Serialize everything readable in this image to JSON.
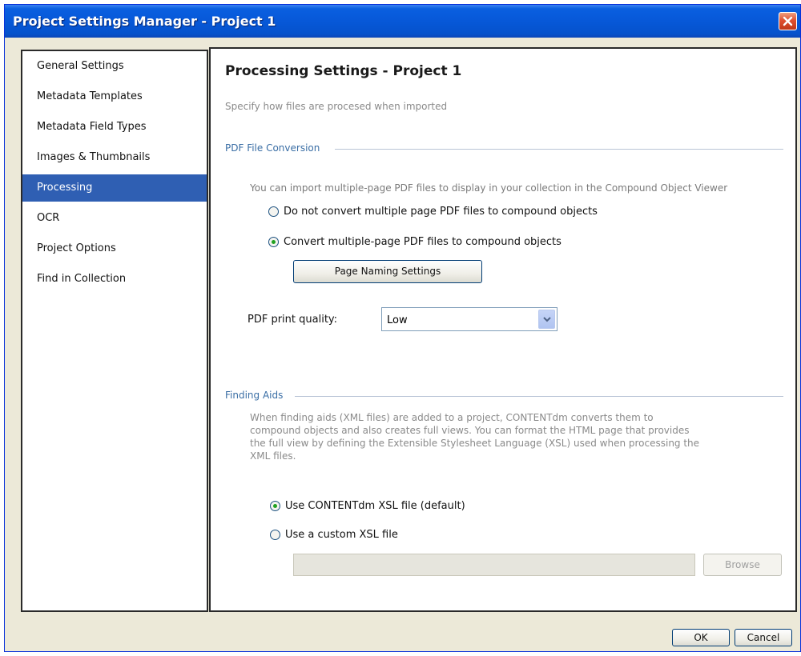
{
  "window": {
    "title": "Project Settings Manager - Project 1",
    "close_icon": "close-x-icon",
    "titlebar_color": "#0758d8"
  },
  "sidebar": {
    "items": [
      {
        "label": "General Settings"
      },
      {
        "label": "Metadata Templates"
      },
      {
        "label": "Metadata Field Types"
      },
      {
        "label": "Images & Thumbnails"
      },
      {
        "label": "Processing",
        "active": true
      },
      {
        "label": "OCR"
      },
      {
        "label": "Project Options"
      },
      {
        "label": "Find in Collection"
      }
    ],
    "active_color": "#2f5fb3"
  },
  "main": {
    "title": "Processing Settings - Project 1",
    "subtitle": "Specify how files are procesed when imported",
    "pdf_section": {
      "label": "PDF File Conversion",
      "description": "You can import multiple-page PDF files to display in your collection in the Compound Object Viewer",
      "option_no_convert": "Do not convert multiple page PDF files to compound objects",
      "option_convert": "Convert multiple-page PDF files to compound objects",
      "selected_option": "convert",
      "page_naming_button": "Page Naming Settings",
      "print_quality_label": "PDF print quality:",
      "print_quality_value": "Low"
    },
    "finding_aids_section": {
      "label": "Finding Aids",
      "description_lines": [
        "When finding aids (XML files) are added to a project, CONTENTdm converts them to",
        "compound objects and also creates full views. You can format the HTML page that provides",
        "the full view by defining the Extensible Stylesheet Language (XSL) used when processing the",
        "XML files."
      ],
      "option_default_xsl": "Use CONTENTdm XSL file (default)",
      "option_custom_xsl": "Use a custom XSL file",
      "selected_option": "default",
      "custom_xsl_path": "",
      "browse_button": "Browse"
    }
  },
  "footer": {
    "ok_button": "OK",
    "cancel_button": "Cancel"
  }
}
